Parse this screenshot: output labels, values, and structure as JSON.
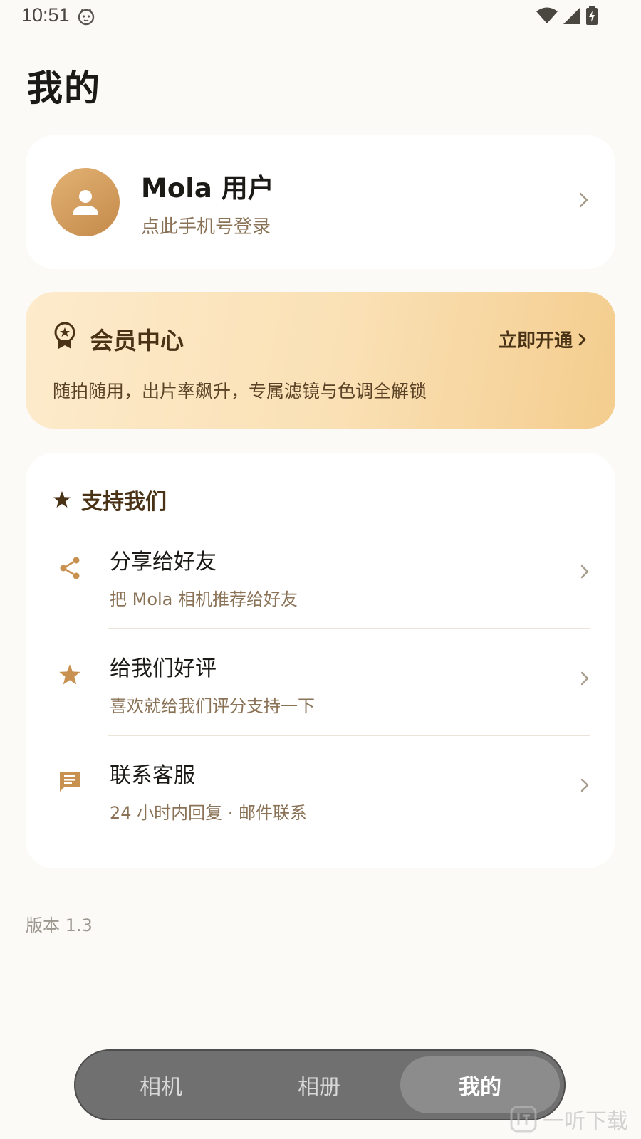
{
  "status": {
    "time": "10:51"
  },
  "page": {
    "title": "我的"
  },
  "profile": {
    "name": "Mola 用户",
    "subtitle": "点此手机号登录"
  },
  "vip": {
    "title": "会员中心",
    "action": "立即开通",
    "description": "随拍随用，出片率飙升，专属滤镜与色调全解锁"
  },
  "support": {
    "title": "支持我们",
    "items": [
      {
        "title": "分享给好友",
        "subtitle": "把 Mola 相机推荐给好友",
        "icon": "share-icon"
      },
      {
        "title": "给我们好评",
        "subtitle": "喜欢就给我们评分支持一下",
        "icon": "star-icon"
      },
      {
        "title": "联系客服",
        "subtitle": "24 小时内回复 · 邮件联系",
        "icon": "chat-icon"
      }
    ]
  },
  "version": "版本 1.3",
  "tabs": {
    "camera": "相机",
    "album": "相册",
    "mine": "我的",
    "active": "mine"
  },
  "watermark": "一听下载",
  "colors": {
    "accent": "#c8914f",
    "background": "#fcfaf7",
    "vip_text": "#4a3217",
    "tabbar": "#707070"
  }
}
